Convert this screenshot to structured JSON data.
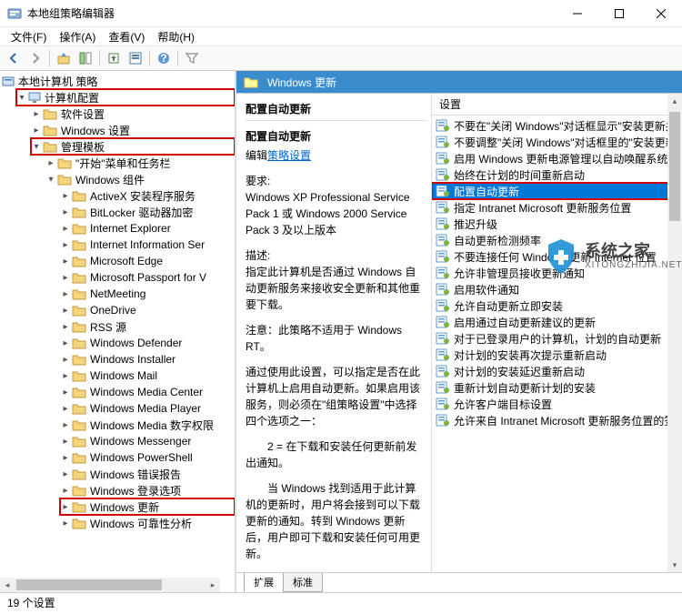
{
  "window": {
    "title": "本地组策略编辑器"
  },
  "menu": {
    "file": "文件(F)",
    "action": "操作(A)",
    "view": "查看(V)",
    "help": "帮助(H)"
  },
  "toolbar_icons": [
    "back",
    "forward",
    "up",
    "sep",
    "show-hide",
    "export",
    "sep",
    "refresh",
    "properties",
    "sep",
    "help",
    "sep",
    "filter"
  ],
  "tree": {
    "root": "本地计算机 策略",
    "computer_config": "计算机配置",
    "software_settings": "软件设置",
    "windows_settings": "Windows 设置",
    "admin_templates": "管理模板",
    "start_taskbar": "\"开始\"菜单和任务栏",
    "windows_components": "Windows 组件",
    "items": [
      "ActiveX 安装程序服务",
      "BitLocker 驱动器加密",
      "Internet Explorer",
      "Internet Information Ser",
      "Microsoft Edge",
      "Microsoft Passport for V",
      "NetMeeting",
      "OneDrive",
      "RSS 源",
      "Windows Defender",
      "Windows Installer",
      "Windows Mail",
      "Windows Media Center",
      "Windows Media Player",
      "Windows Media 数字权限",
      "Windows Messenger",
      "Windows PowerShell",
      "Windows 错误报告",
      "Windows 登录选项",
      "Windows 更新",
      "Windows 可靠性分析"
    ],
    "highlight_item": "Windows 更新"
  },
  "right": {
    "header": "Windows 更新",
    "detail": {
      "col_title": "配置自动更新",
      "title": "配置自动更新",
      "edit_label": "编辑",
      "policy_link": "策略设置",
      "req_label": "要求:",
      "req_body": "Windows XP Professional Service Pack 1 或 Windows 2000 Service Pack 3 及以上版本",
      "desc_label": "描述:",
      "desc_p1": "指定此计算机是否通过 Windows 自动更新服务来接收安全更新和其他重要下载。",
      "desc_note": "注意：此策略不适用于 Windows RT。",
      "desc_p2": "通过使用此设置，可以指定是否在此计算机上启用自动更新。如果启用该服务，则必须在\"组策略设置\"中选择四个选项之一：",
      "desc_p3": "2 = 在下载和安装任何更新前发出通知。",
      "desc_p4": "当 Windows 找到适用于此计算机的更新时，用户将会接到可以下载更新的通知。转到 Windows 更新后，用户即可下载和安装任何可用更新。"
    },
    "list_header": "设置",
    "list": [
      "不要在\"关闭 Windows\"对话框显示\"安装更新并",
      "不要调整\"关闭 Windows\"对话框里的\"安装更新",
      "启用 Windows 更新电源管理以自动唤醒系统来",
      "始终在计划的时间重新启动",
      "配置自动更新",
      "指定 Intranet Microsoft 更新服务位置",
      "推迟升级",
      "自动更新检测频率",
      "不要连接任何 Windows 更新 Internet 位置",
      "允许非管理员接收更新通知",
      "启用软件通知",
      "允许自动更新立即安装",
      "启用通过自动更新建议的更新",
      "对于已登录用户的计算机，计划的自动更新",
      "对计划的安装再次提示重新启动",
      "对计划的安装延迟重新启动",
      "重新计划自动更新计划的安装",
      "允许客户端目标设置",
      "允许来自 Intranet Microsoft 更新服务位置的签"
    ],
    "selected_index": 4
  },
  "tabs": {
    "extended": "扩展",
    "standard": "标准"
  },
  "status": "19 个设置",
  "watermark": {
    "t1": "系统之家",
    "t2": "XITONGZHIJIA.NET"
  }
}
